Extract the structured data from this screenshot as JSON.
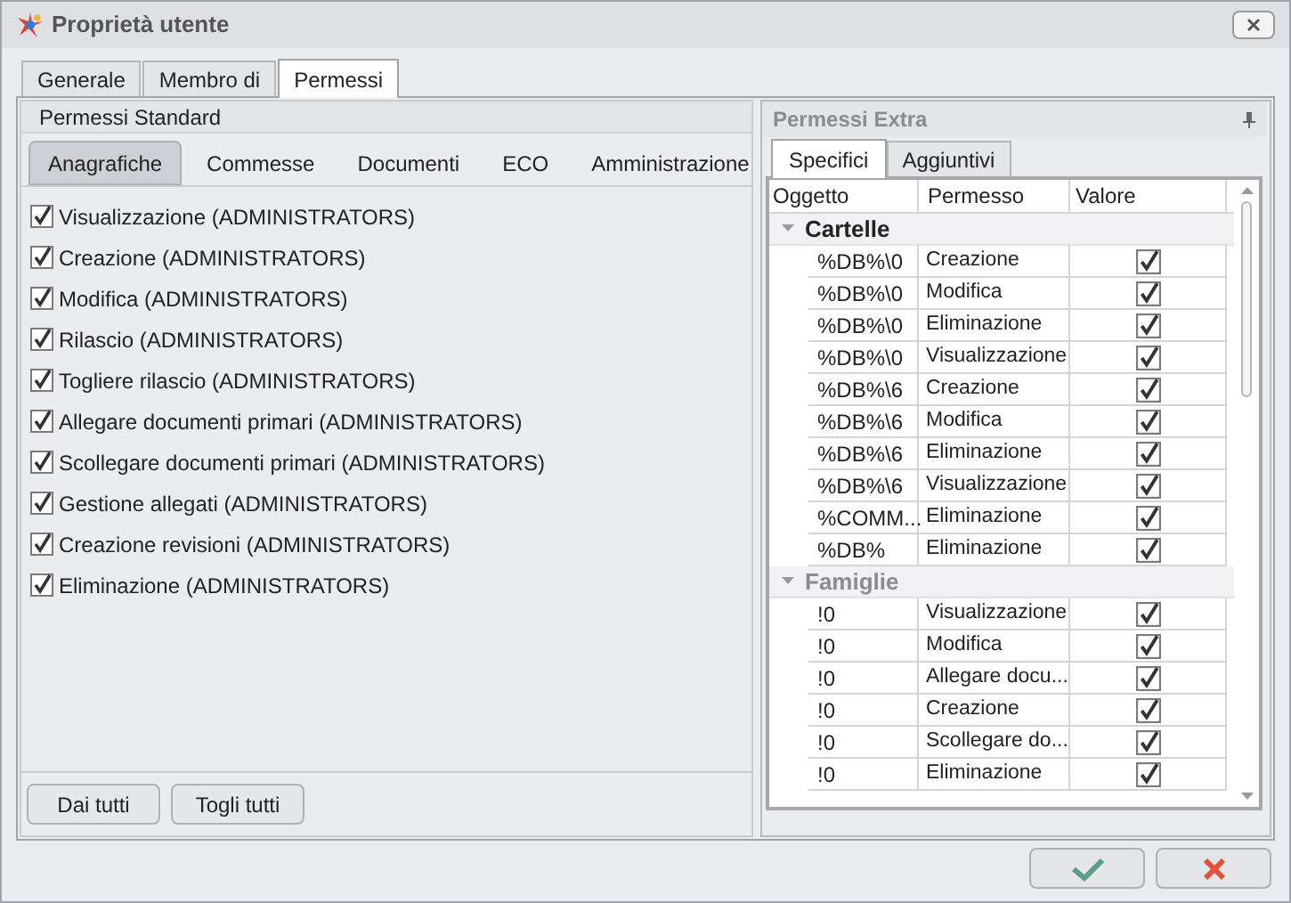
{
  "window": {
    "title": "Proprietà utente"
  },
  "tabs": [
    {
      "label": "Generale",
      "selected": false
    },
    {
      "label": "Membro di",
      "selected": false
    },
    {
      "label": "Permessi",
      "selected": true
    }
  ],
  "standard": {
    "title": "Permessi Standard",
    "tabs": [
      {
        "label": "Anagrafiche",
        "selected": true
      },
      {
        "label": "Commesse",
        "selected": false
      },
      {
        "label": "Documenti",
        "selected": false
      },
      {
        "label": "ECO",
        "selected": false
      },
      {
        "label": "Amministrazione",
        "selected": false
      }
    ],
    "items": [
      {
        "label": "Visualizzazione (ADMINISTRATORS)",
        "checked": true
      },
      {
        "label": "Creazione (ADMINISTRATORS)",
        "checked": true
      },
      {
        "label": "Modifica (ADMINISTRATORS)",
        "checked": true
      },
      {
        "label": "Rilascio (ADMINISTRATORS)",
        "checked": true
      },
      {
        "label": "Togliere rilascio (ADMINISTRATORS)",
        "checked": true
      },
      {
        "label": "Allegare documenti primari (ADMINISTRATORS)",
        "checked": true
      },
      {
        "label": "Scollegare documenti primari (ADMINISTRATORS)",
        "checked": true
      },
      {
        "label": "Gestione allegati (ADMINISTRATORS)",
        "checked": true
      },
      {
        "label": "Creazione revisioni (ADMINISTRATORS)",
        "checked": true
      },
      {
        "label": "Eliminazione (ADMINISTRATORS)",
        "checked": true
      }
    ],
    "buttons": [
      "Dai tutti",
      "Togli tutti"
    ]
  },
  "extra": {
    "title": "Permessi Extra",
    "tabs": [
      {
        "label": "Specifici",
        "selected": true
      },
      {
        "label": "Aggiuntivi",
        "selected": false
      }
    ],
    "columns": [
      "Oggetto",
      "Permesso",
      "Valore"
    ],
    "groups": [
      {
        "name": "Cartelle",
        "selected": true,
        "expanded": true,
        "rows": [
          {
            "object": "%DB%\\0",
            "permission": "Creazione",
            "checked": true
          },
          {
            "object": "%DB%\\0",
            "permission": "Modifica",
            "checked": true
          },
          {
            "object": "%DB%\\0",
            "permission": "Eliminazione",
            "checked": true
          },
          {
            "object": "%DB%\\0",
            "permission": "Visualizzazione",
            "checked": true
          },
          {
            "object": "%DB%\\6",
            "permission": "Creazione",
            "checked": true
          },
          {
            "object": "%DB%\\6",
            "permission": "Modifica",
            "checked": true
          },
          {
            "object": "%DB%\\6",
            "permission": "Eliminazione",
            "checked": true
          },
          {
            "object": "%DB%\\6",
            "permission": "Visualizzazione",
            "checked": true
          },
          {
            "object": "%COMM...",
            "permission": "Eliminazione",
            "checked": true
          },
          {
            "object": "%DB%",
            "permission": "Eliminazione",
            "checked": true
          }
        ]
      },
      {
        "name": "Famiglie",
        "selected": false,
        "expanded": true,
        "rows": [
          {
            "object": "!0",
            "permission": "Visualizzazione",
            "checked": true
          },
          {
            "object": "!0",
            "permission": "Modifica",
            "checked": true
          },
          {
            "object": "!0",
            "permission": "Allegare docu...",
            "checked": true
          },
          {
            "object": "!0",
            "permission": "Creazione",
            "checked": true
          },
          {
            "object": "!0",
            "permission": "Scollegare do...",
            "checked": true
          },
          {
            "object": "!0",
            "permission": "Eliminazione",
            "checked": true
          }
        ]
      }
    ]
  }
}
